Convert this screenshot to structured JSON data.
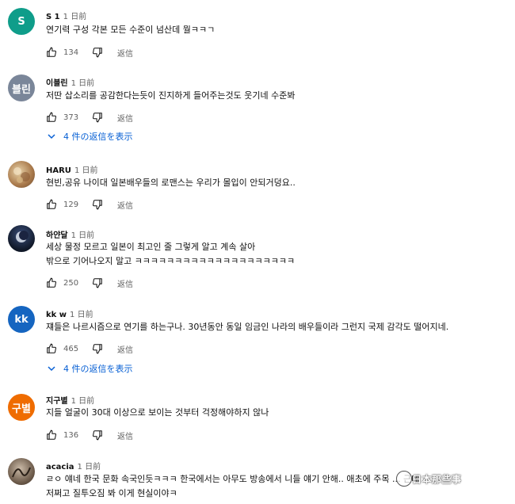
{
  "time_ago": "1 日前",
  "reply_label": "返信",
  "comments": [
    {
      "author": "S 1",
      "avatar_text": "S",
      "avatar_color": "#0f9d8a",
      "lines": [
        "연기력 구성 각본 모든 수준이 넘산데 뭘ㅋㅋㄱ"
      ],
      "likes": "134"
    },
    {
      "author": "이블린",
      "avatar_text": "블린",
      "avatar_color": "#7a8699",
      "lines": [
        "저딴 삽소리를 공감한다는듯이 진지하게 들어주는것도 웃기네 수준봐"
      ],
      "likes": "373",
      "replies": "4 件の返信を表示"
    },
    {
      "author": "HARU",
      "avatar_text": "",
      "avatar_color": "#b8895c",
      "lines": [
        "현빈,공유 나이대 일본배우들의 로맨스는 우리가 몰입이 안되거덩요.."
      ],
      "likes": "129"
    },
    {
      "author": "하얀달",
      "avatar_text": "",
      "avatar_color": "#1b2440",
      "lines": [
        "세상 물정 모르고 일본이 최고인 줄 그렇게 알고 계속 살아",
        "밖으로 기어나오지 말고 ㅋㅋㅋㅋㅋㅋㅋㅋㅋㅋㅋㅋㅋㅋㅋㅋㅋㅋㅋㅋ"
      ],
      "likes": "250"
    },
    {
      "author": "kk w",
      "avatar_text": "kk",
      "avatar_color": "#1565c0",
      "lines": [
        "쟤들은 나르시즘으로 연기를 하는구나. 30년동안 동일 임금인 나라의 배우들이라 그런지 국제 감각도 떨어지네."
      ],
      "likes": "465",
      "replies": "4 件の返信を表示"
    },
    {
      "author": "지구별",
      "avatar_text": "구별",
      "avatar_color": "#ef6c00",
      "lines": [
        "지들 얼굴이 30대 이상으로 보이는 것부터 걱정해야하지 않나"
      ],
      "likes": "136"
    },
    {
      "author": "acacia",
      "avatar_text": "",
      "avatar_color": "#7d6a5a",
      "lines": [
        "ㄹㅇ 얘네 한국 문화 속국인듯ㅋㅋㅋ 한국에서는 아무도 방송에서 니들 얘기 안해.. 애초에 주목 ... 근데",
        "저쩌고 질투오짐 봐 이게 현실이야ㅋ"
      ]
    }
  ],
  "watermark": "日本那些事"
}
